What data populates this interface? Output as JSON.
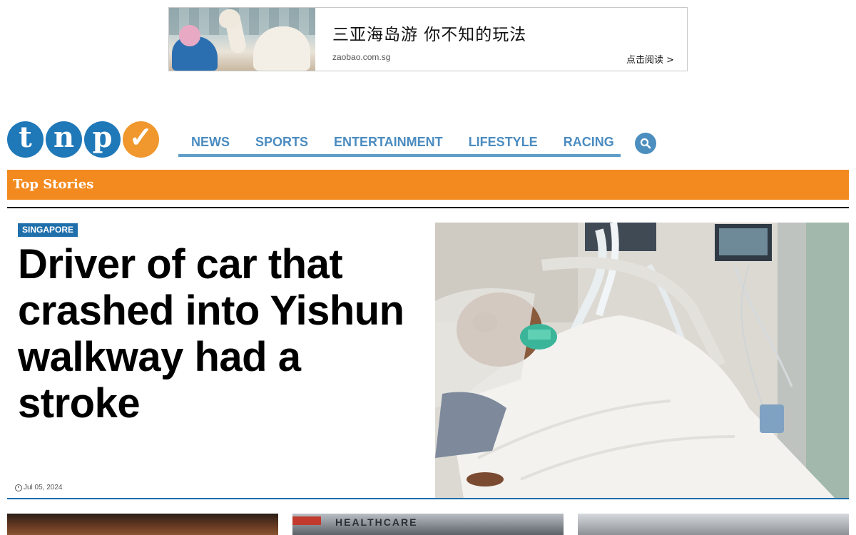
{
  "ad": {
    "title": "三亚海岛游 你不知的玩法",
    "domain": "zaobao.com.sg",
    "cta": "点击阅读 >"
  },
  "logo": {
    "letters": [
      "t",
      "n",
      "p",
      "✓"
    ]
  },
  "nav": {
    "items": [
      "NEWS",
      "SPORTS",
      "ENTERTAINMENT",
      "LIFESTYLE",
      "RACING"
    ]
  },
  "section": {
    "title": "Top Stories"
  },
  "main_story": {
    "tag": "SINGAPORE",
    "headline": "Driver of car that crashed into Yishun walkway had a stroke",
    "date": "Jul 05, 2024"
  },
  "thumbnails": {
    "thumb2_sign": "HEALTHCARE"
  },
  "colors": {
    "brand_blue": "#1f78b8",
    "brand_orange": "#f0982d",
    "section_orange": "#f38a1f",
    "nav_blue": "#4b8cc1"
  }
}
